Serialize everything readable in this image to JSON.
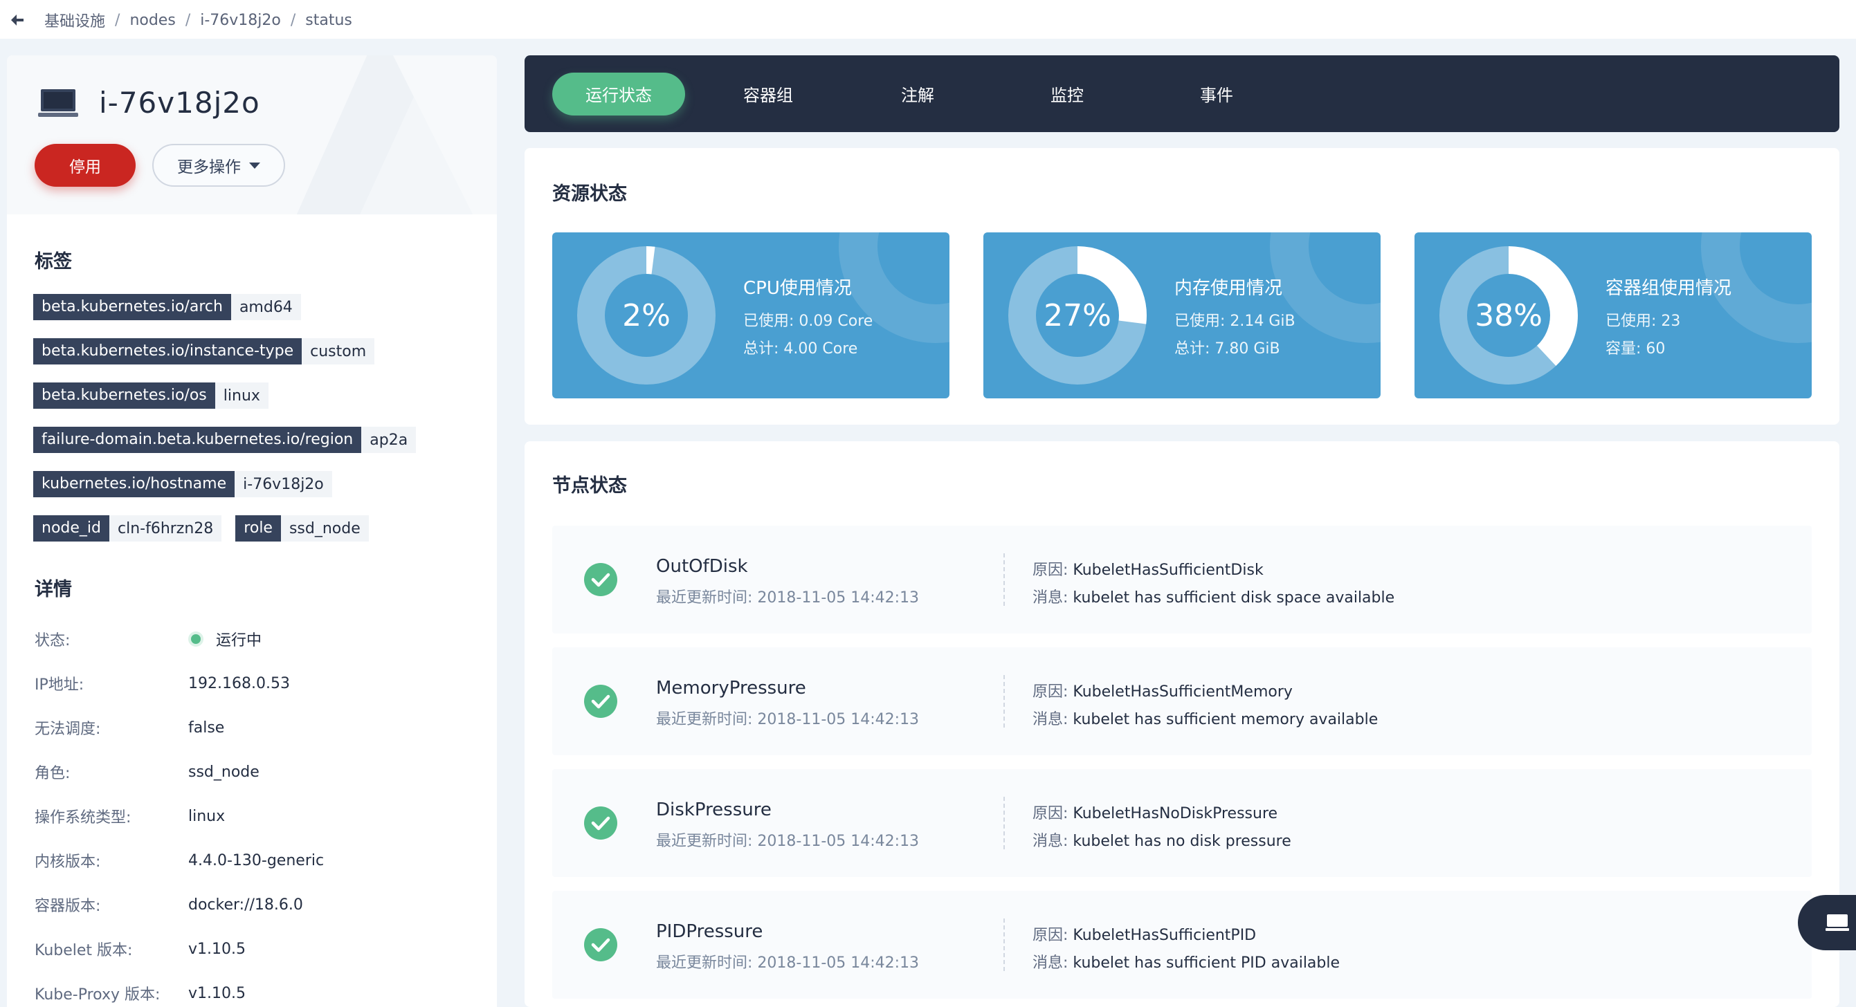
{
  "breadcrumb": {
    "items": [
      "基础设施",
      "nodes",
      "i-76v18j2o",
      "status"
    ],
    "separator": "/"
  },
  "node": {
    "name": "i-76v18j2o",
    "actions": {
      "stop_label": "停用",
      "more_label": "更多操作"
    }
  },
  "labels_section": {
    "title": "标签",
    "tags": [
      {
        "key": "beta.kubernetes.io/arch",
        "value": "amd64"
      },
      {
        "key": "beta.kubernetes.io/instance-type",
        "value": "custom"
      },
      {
        "key": "beta.kubernetes.io/os",
        "value": "linux"
      },
      {
        "key": "failure-domain.beta.kubernetes.io/region",
        "value": "ap2a"
      },
      {
        "key": "kubernetes.io/hostname",
        "value": "i-76v18j2o"
      },
      {
        "key": "node_id",
        "value": "cln-f6hrzn28"
      },
      {
        "key": "role",
        "value": "ssd_node"
      }
    ]
  },
  "details": {
    "title": "详情",
    "rows": [
      {
        "label": "状态:",
        "value": "运行中"
      },
      {
        "label": "IP地址:",
        "value": "192.168.0.53"
      },
      {
        "label": "无法调度:",
        "value": "false"
      },
      {
        "label": "角色:",
        "value": "ssd_node"
      },
      {
        "label": "操作系统类型:",
        "value": "linux"
      },
      {
        "label": "内核版本:",
        "value": "4.4.0-130-generic"
      },
      {
        "label": "容器版本:",
        "value": "docker://18.6.0"
      },
      {
        "label": "Kubelet 版本:",
        "value": "v1.10.5"
      },
      {
        "label": "Kube-Proxy 版本:",
        "value": "v1.10.5"
      }
    ]
  },
  "tabs": [
    {
      "label": "运行状态",
      "active": true
    },
    {
      "label": "容器组",
      "active": false
    },
    {
      "label": "注解",
      "active": false
    },
    {
      "label": "监控",
      "active": false
    },
    {
      "label": "事件",
      "active": false
    }
  ],
  "resource_status": {
    "title": "资源状态",
    "items": [
      {
        "percent_label": "2%",
        "percent": 0.02,
        "title": "CPU使用情况",
        "line1": "已使用: 0.09 Core",
        "line2": "总计: 4.00 Core"
      },
      {
        "percent_label": "27%",
        "percent": 0.27,
        "title": "内存使用情况",
        "line1": "已使用: 2.14 GiB",
        "line2": "总计: 7.80 GiB"
      },
      {
        "percent_label": "38%",
        "percent": 0.38,
        "title": "容器组使用情况",
        "line1": "已使用: 23",
        "line2": "容量: 60"
      }
    ]
  },
  "node_status": {
    "title": "节点状态",
    "reason_prefix": "原因: ",
    "message_prefix": "消息: ",
    "conditions": [
      {
        "name": "OutOfDisk",
        "time": "最近更新时间: 2018-11-05 14:42:13",
        "reason": "KubeletHasSufficientDisk",
        "message": "kubelet has sufficient disk space available"
      },
      {
        "name": "MemoryPressure",
        "time": "最近更新时间: 2018-11-05 14:42:13",
        "reason": "KubeletHasSufficientMemory",
        "message": "kubelet has sufficient memory available"
      },
      {
        "name": "DiskPressure",
        "time": "最近更新时间: 2018-11-05 14:42:13",
        "reason": "KubeletHasNoDiskPressure",
        "message": "kubelet has no disk pressure"
      },
      {
        "name": "PIDPressure",
        "time": "最近更新时间: 2018-11-05 14:42:13",
        "reason": "KubeletHasSufficientPID",
        "message": "kubelet has sufficient PID available"
      }
    ]
  },
  "colors": {
    "accent_green": "#55bc8a",
    "danger_red": "#ca2621",
    "dark_nav": "#242e42",
    "resource_blue": "#4a9fd1"
  },
  "icons": {
    "back": "back-arrow-icon",
    "node": "computer-icon",
    "status_ok": "check-circle-icon",
    "float": "kubectl-terminal-icon"
  }
}
